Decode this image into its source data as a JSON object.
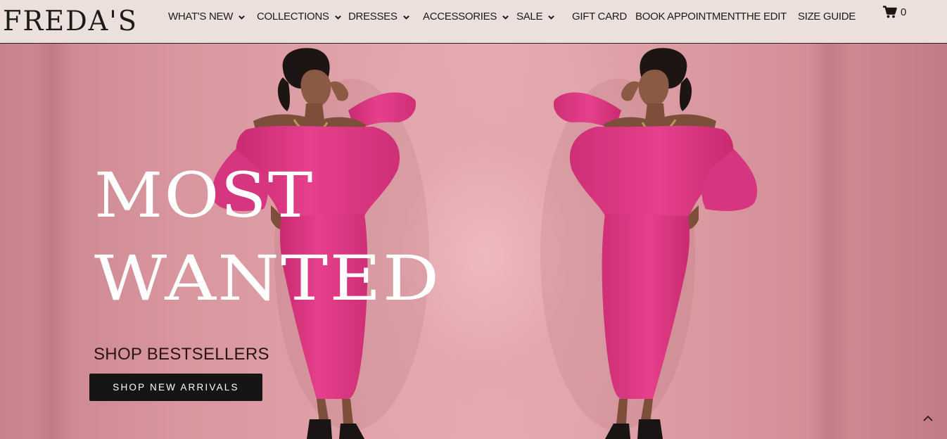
{
  "brand": {
    "logo": "FREDA'S"
  },
  "nav": {
    "items": [
      {
        "label": "WHAT'S NEW",
        "has_dropdown": true
      },
      {
        "label": "COLLECTIONS",
        "has_dropdown": true
      },
      {
        "label": "DRESSES",
        "has_dropdown": true
      },
      {
        "label": "ACCESSORIES",
        "has_dropdown": true
      },
      {
        "label": "SALE",
        "has_dropdown": true
      },
      {
        "label": "GIFT CARD",
        "has_dropdown": false
      },
      {
        "label": "BOOK APPOINTMENT",
        "has_dropdown": false
      },
      {
        "label": "THE EDIT",
        "has_dropdown": false
      },
      {
        "label": "SIZE GUIDE",
        "has_dropdown": false
      }
    ],
    "cart_count": "0",
    "cart_icon": "shopping-cart-icon",
    "dropdown_icon": "chevron-down-icon"
  },
  "hero": {
    "headline_line1": "MOST",
    "headline_line2": "WANTED",
    "shop_bestsellers": "SHOP BESTSELLERS",
    "shop_new_arrivals": "SHOP NEW ARRIVALS",
    "scroll_top_icon": "chevron-up-icon"
  },
  "colors": {
    "header_bg": "#ebe0dc",
    "hero_bg": "#e0a4aa",
    "dress": "#e23a86",
    "button_bg": "#161414",
    "headline": "#ffffff"
  }
}
